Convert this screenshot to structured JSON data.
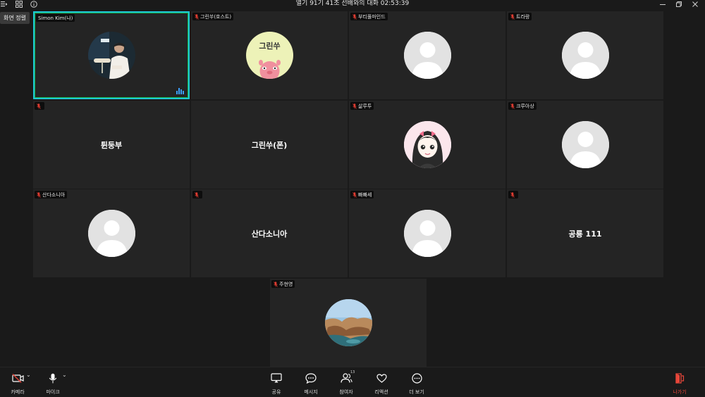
{
  "window": {
    "title": "열기 91기 41조 선배와의 대화 02:53:39",
    "left_icons": [
      "participants-list-icon",
      "grid-view-icon",
      "info-icon"
    ],
    "controls": [
      "minimize-icon",
      "restore-icon",
      "close-icon"
    ]
  },
  "view_button": {
    "label": "화면 정렬"
  },
  "colors": {
    "background": "#1a1a1a",
    "tile": "#242424",
    "active_border": "#1ec6d6",
    "mic_off": "#e03c31",
    "leave": "#e8463a",
    "speaking": "#3aa0ff"
  },
  "participants": [
    {
      "name": "Simon Kim(나)",
      "display": "photo",
      "active": true,
      "muted": false,
      "speaking": true
    },
    {
      "name": "그린쑤(호스트)",
      "display": "illustration",
      "avatar_text": "그린쑤",
      "muted": true
    },
    {
      "name": "부티풀마인드",
      "display": "default",
      "muted": true
    },
    {
      "name": "트라랑",
      "display": "default",
      "muted": true
    },
    {
      "name": "",
      "center_name": "튄둥부",
      "display": "name",
      "muted": true
    },
    {
      "name": "",
      "center_name": "그린쑤(폰)",
      "display": "name",
      "muted": false
    },
    {
      "name": "삶루투",
      "display": "illustration-girl",
      "muted": true
    },
    {
      "name": "크루아상",
      "display": "default",
      "muted": true
    },
    {
      "name": "산다소니아",
      "display": "default",
      "muted": true
    },
    {
      "name": "",
      "center_name": "산다소니아",
      "display": "name",
      "muted": true
    },
    {
      "name": "빠빠세",
      "display": "default",
      "muted": true
    },
    {
      "name": "",
      "center_name": "공룡 111",
      "display": "name",
      "muted": true
    },
    {
      "name": "주현영",
      "display": "landscape",
      "muted": true
    }
  ],
  "toolbar": {
    "camera": {
      "label": "카메라",
      "icon": "camera-off-icon"
    },
    "mic": {
      "label": "마이크",
      "icon": "microphone-icon"
    },
    "share": {
      "label": "공유",
      "icon": "share-screen-icon"
    },
    "message": {
      "label": "메시지",
      "icon": "chat-icon"
    },
    "participants": {
      "label": "참여자",
      "icon": "participants-icon",
      "count": "13"
    },
    "reaction": {
      "label": "리액션",
      "icon": "heart-icon"
    },
    "more": {
      "label": "더 보기",
      "icon": "more-icon"
    },
    "leave": {
      "label": "나가기",
      "icon": "leave-icon"
    }
  }
}
